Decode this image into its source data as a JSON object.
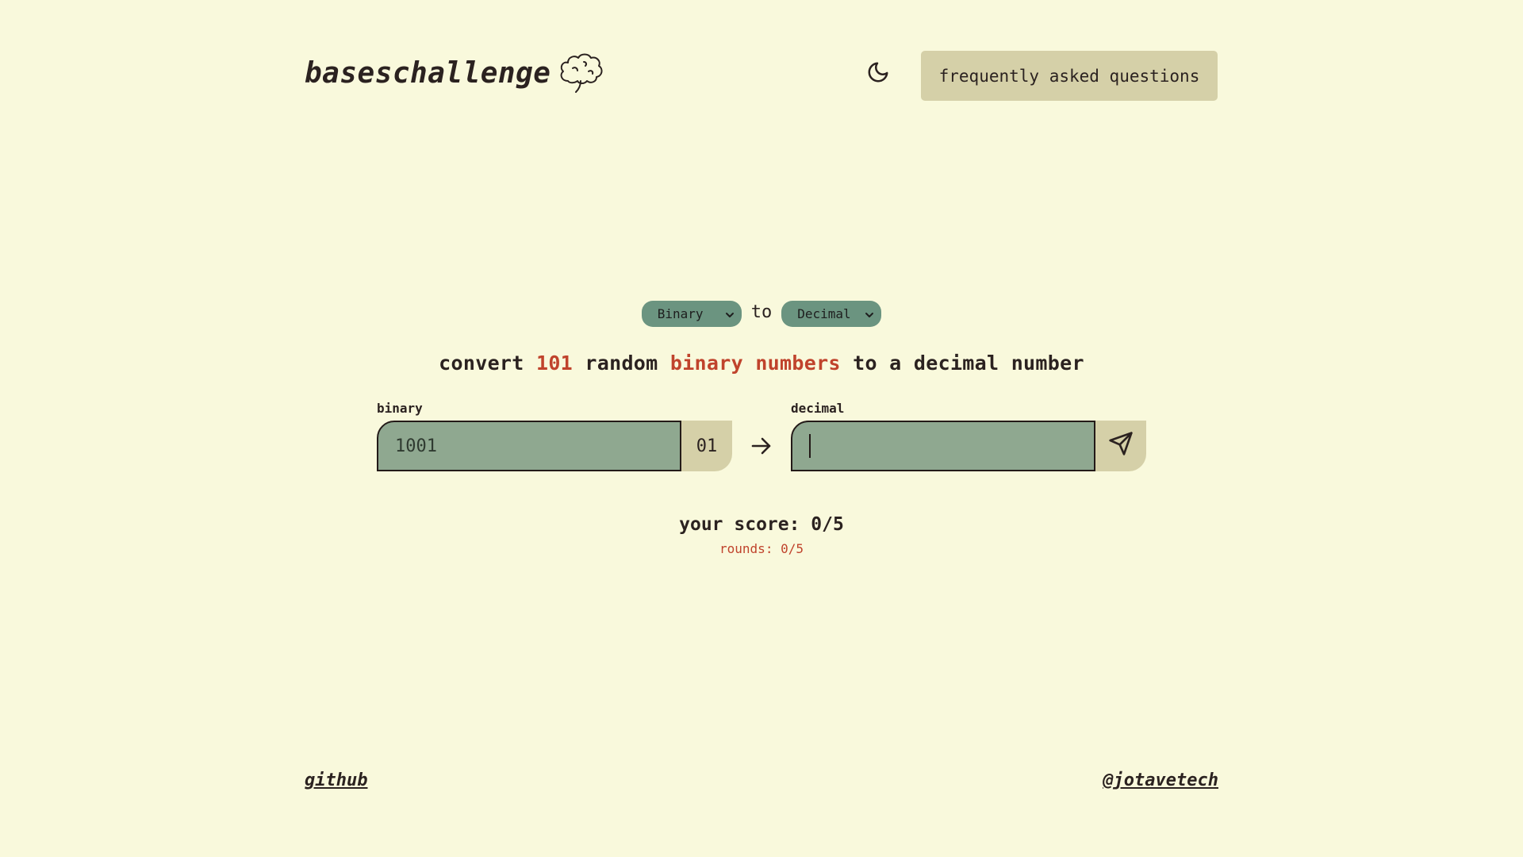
{
  "header": {
    "logo_text": "baseschallenge",
    "logo_icon": "brain-icon",
    "theme_icon": "moon-icon",
    "faq_label": "frequently asked questions"
  },
  "selectors": {
    "from_value": "Binary",
    "to_label": "to",
    "to_value": "Decimal"
  },
  "prompt": {
    "part1": "convert ",
    "count": "101",
    "part2": " random ",
    "from_base": "binary numbers",
    "part3": " to a decimal number"
  },
  "converter": {
    "source_label": "binary",
    "source_value": "1001",
    "source_suffix": "01",
    "arrow_icon": "arrow-right-icon",
    "target_label": "decimal",
    "target_value": "",
    "submit_icon": "send-icon"
  },
  "score": {
    "score_text": "your score: 0/5",
    "rounds_text": "rounds: 0/5"
  },
  "footer": {
    "github_label": "github",
    "handle_label": "@jotavetech"
  },
  "colors": {
    "background": "#f9f9dc",
    "text": "#2b2220",
    "accent": "#c0432c",
    "select_bg": "#6b9480",
    "input_bg": "#8fa890",
    "button_bg": "#d5d0a8"
  }
}
